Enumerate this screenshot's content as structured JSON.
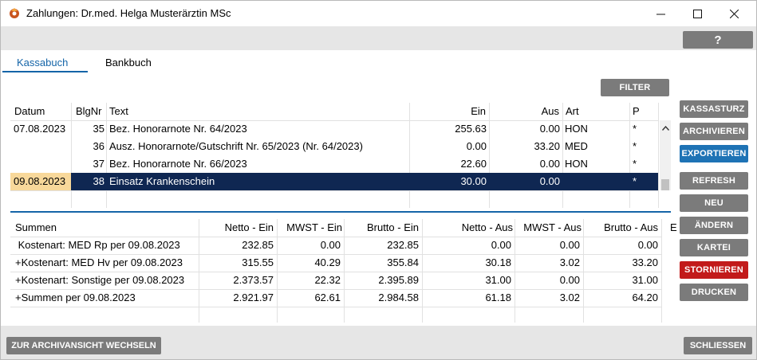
{
  "window": {
    "title": "Zahlungen: Dr.med. Helga Musterärztin MSc"
  },
  "help_label": "?",
  "tabs": [
    {
      "label": "Kassabuch",
      "active": true
    },
    {
      "label": "Bankbuch",
      "active": false
    }
  ],
  "filter_label": "FILTER",
  "side_buttons": [
    {
      "label": "KASSASTURZ",
      "style": "gray"
    },
    {
      "label": "ARCHIVIEREN",
      "style": "gray"
    },
    {
      "label": "EXPORTIEREN",
      "style": "blue"
    },
    {
      "label": "REFRESH",
      "style": "gray"
    },
    {
      "label": "NEU",
      "style": "gray"
    },
    {
      "label": "ÄNDERN",
      "style": "gray"
    },
    {
      "label": "KARTEI",
      "style": "gray"
    },
    {
      "label": "STORNIEREN",
      "style": "red"
    },
    {
      "label": "DRUCKEN",
      "style": "gray"
    }
  ],
  "kassabuch": {
    "columns": [
      "Datum",
      "BlgNr",
      "Text",
      "Ein",
      "Aus",
      "Art",
      "P"
    ],
    "rows": [
      {
        "datum": "07.08.2023",
        "blgnr": "35",
        "text": "Bez. Honorarnote Nr. 64/2023",
        "ein": "255.63",
        "aus": "0.00",
        "art": "HON",
        "p": "*"
      },
      {
        "datum": "",
        "blgnr": "36",
        "text": "Ausz. Honorarnote/Gutschrift Nr. 65/2023 (Nr. 64/2023)",
        "ein": "0.00",
        "aus": "33.20",
        "art": "MED",
        "p": "*"
      },
      {
        "datum": "",
        "blgnr": "37",
        "text": "Bez. Honorarnote Nr. 66/2023",
        "ein": "22.60",
        "aus": "0.00",
        "art": "HON",
        "p": "*"
      },
      {
        "datum": "09.08.2023",
        "blgnr": "38",
        "text": "Einsatz Krankenschein",
        "ein": "30.00",
        "aus": "0.00",
        "art": "",
        "p": "*"
      }
    ],
    "selected_row": 3
  },
  "summen": {
    "columns": [
      "Summen",
      "Netto - Ein",
      "MWST - Ein",
      "Brutto - Ein",
      "Netto - Aus",
      "MWST - Aus",
      "Brutto - Aus",
      "E"
    ],
    "rows": [
      {
        "label": " Kostenart: MED Rp per 09.08.2023",
        "netto_ein": "232.85",
        "mwst_ein": "0.00",
        "brutto_ein": "232.85",
        "netto_aus": "0.00",
        "mwst_aus": "0.00",
        "brutto_aus": "0.00"
      },
      {
        "label": "+Kostenart: MED Hv per 09.08.2023",
        "netto_ein": "315.55",
        "mwst_ein": "40.29",
        "brutto_ein": "355.84",
        "netto_aus": "30.18",
        "mwst_aus": "3.02",
        "brutto_aus": "33.20"
      },
      {
        "label": "+Kostenart: Sonstige per 09.08.2023",
        "netto_ein": "2.373.57",
        "mwst_ein": "22.32",
        "brutto_ein": "2.395.89",
        "netto_aus": "31.00",
        "mwst_aus": "0.00",
        "brutto_aus": "31.00"
      },
      {
        "label": "+Summen per 09.08.2023",
        "netto_ein": "2.921.97",
        "mwst_ein": "62.61",
        "brutto_ein": "2.984.58",
        "netto_aus": "61.18",
        "mwst_aus": "3.02",
        "brutto_aus": "64.20"
      }
    ]
  },
  "bottom": {
    "archive_view_label": "ZUR ARCHIVANSICHT WECHSELN",
    "close_label": "SCHLIESSEN"
  },
  "colors": {
    "accent": "#1565a8",
    "selected_row": "#0f2752",
    "date_highlight": "#f8d89a",
    "button_gray": "#7b7b7b",
    "button_blue": "#1e73b5",
    "button_red": "#c21a1a"
  }
}
